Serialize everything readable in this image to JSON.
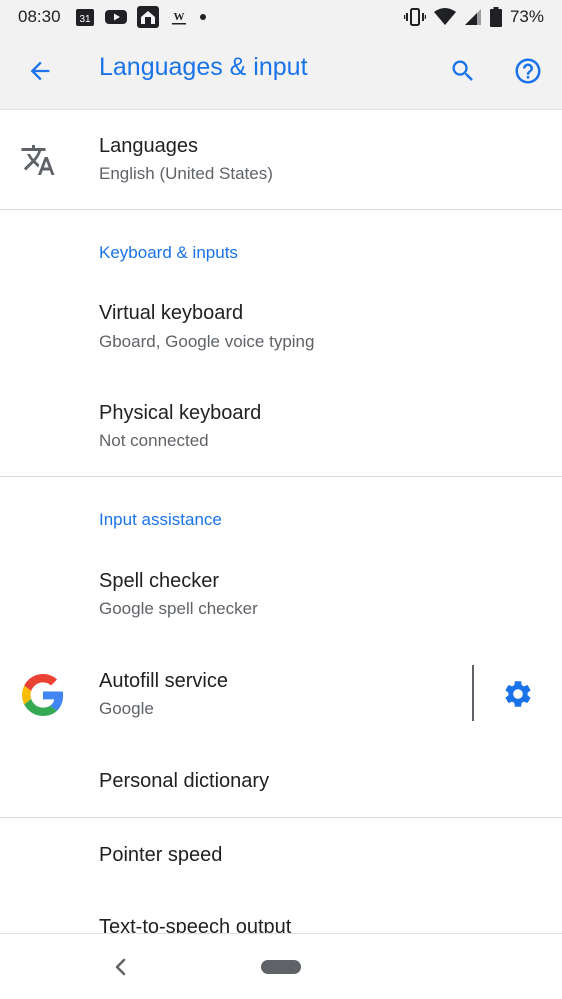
{
  "status_bar": {
    "time": "08:30",
    "calendar_day": "31",
    "w_label": "W",
    "battery": "73%"
  },
  "app_bar": {
    "title": "Languages & input"
  },
  "list": {
    "languages": {
      "title": "Languages",
      "subtitle": "English (United States)"
    },
    "keyboard_section": "Keyboard & inputs",
    "virtual_keyboard": {
      "title": "Virtual keyboard",
      "subtitle": "Gboard, Google voice typing"
    },
    "physical_keyboard": {
      "title": "Physical keyboard",
      "subtitle": "Not connected"
    },
    "input_section": "Input assistance",
    "spell_checker": {
      "title": "Spell checker",
      "subtitle": "Google spell checker"
    },
    "autofill": {
      "title": "Autofill service",
      "subtitle": "Google"
    },
    "personal_dictionary": {
      "title": "Personal dictionary"
    },
    "pointer_speed": {
      "title": "Pointer speed"
    },
    "tts": {
      "title": "Text-to-speech output"
    }
  },
  "colors": {
    "accent": "#1a73e8",
    "text_primary": "#202124",
    "text_secondary": "#5f6368",
    "bar_background": "#f2f2f2"
  }
}
